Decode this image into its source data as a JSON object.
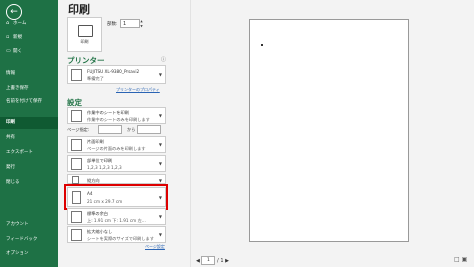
{
  "sidebar": {
    "back": "←",
    "items": [
      {
        "label": "ホーム",
        "icon": "⌂"
      },
      {
        "label": "新規",
        "icon": "▫"
      },
      {
        "label": "開く",
        "icon": "▭"
      },
      {
        "label": "情報",
        "icon": ""
      },
      {
        "label": "上書き保存",
        "icon": ""
      },
      {
        "label": "名前を付けて保存",
        "icon": ""
      },
      {
        "label": "印刷",
        "icon": ""
      },
      {
        "label": "共有",
        "icon": ""
      },
      {
        "label": "エクスポート",
        "icon": ""
      },
      {
        "label": "発行",
        "icon": ""
      },
      {
        "label": "閉じる",
        "icon": ""
      },
      {
        "label": "アカウント",
        "icon": ""
      },
      {
        "label": "フィードバック",
        "icon": ""
      },
      {
        "label": "オプション",
        "icon": ""
      }
    ],
    "active": "印刷"
  },
  "print": {
    "title": "印刷",
    "button_label": "印刷",
    "copies_label": "部数:",
    "copies_value": "1"
  },
  "printer": {
    "heading": "プリンター",
    "name": "FUJITSU XL-9380_Prsavi2",
    "status": "準備完了",
    "properties_link": "プリンターのプロパティ"
  },
  "settings": {
    "heading": "設定",
    "scope": {
      "line1": "作業中のシートを印刷",
      "line2": "作業中のシートのみを印刷します"
    },
    "pages_label": "ページ指定:",
    "pages_to": "から",
    "sides": {
      "line1": "片面印刷",
      "line2": "ページの片面のみを印刷します"
    },
    "collate": {
      "line1": "部単位で印刷",
      "line2": "1,2,3    1,2,3    1,2,3"
    },
    "orientation": {
      "line1": "縦方向",
      "line2": ""
    },
    "paper": {
      "line1": "A4",
      "line2": "21 cm x 29.7 cm"
    },
    "margins": {
      "line1": "標準の余白",
      "line2": "上: 1.91 cm 下: 1.91 cm 左..."
    },
    "scaling": {
      "line1": "拡大縮小なし",
      "line2": "シートを実際のサイズで印刷します"
    },
    "page_setup_link": "ページ設定"
  },
  "preview_nav": {
    "prev": "◀",
    "current": "1",
    "total": "/ 1",
    "next": "▶"
  },
  "icons": {
    "show_margins": "□",
    "zoom_page": "▣"
  }
}
